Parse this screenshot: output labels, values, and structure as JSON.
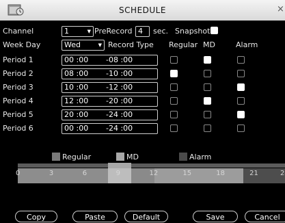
{
  "window": {
    "title": "SCHEDULE",
    "close_glyph": "×"
  },
  "channel": {
    "label": "Channel",
    "value": "1"
  },
  "prerecord": {
    "label": "PreRecord",
    "value": "4",
    "unit": "sec."
  },
  "snapshot": {
    "label": "Snapshot",
    "checked": true
  },
  "weekday": {
    "label": "Week Day",
    "value": "Wed"
  },
  "columns": {
    "record_type": "Record Type",
    "regular": "Regular",
    "md": "MD",
    "alarm": "Alarm"
  },
  "periods": [
    {
      "label": "Period 1",
      "start": "00 :00",
      "end": "-08 :00",
      "regular": false,
      "md": true,
      "alarm": false
    },
    {
      "label": "Period 2",
      "start": "08 :00",
      "end": "-10 :00",
      "regular": true,
      "md": false,
      "alarm": false
    },
    {
      "label": "Period 3",
      "start": "10 :00",
      "end": "-12 :00",
      "regular": false,
      "md": false,
      "alarm": true
    },
    {
      "label": "Period 4",
      "start": "12 :00",
      "end": "-20 :00",
      "regular": false,
      "md": true,
      "alarm": false
    },
    {
      "label": "Period 5",
      "start": "20 :00",
      "end": "-24 :00",
      "regular": false,
      "md": false,
      "alarm": true
    },
    {
      "label": "Period 6",
      "start": "00 :00",
      "end": "-24 :00",
      "regular": false,
      "md": false,
      "alarm": false
    }
  ],
  "legend": [
    {
      "label": "Regular",
      "color": "#7a7a7a"
    },
    {
      "label": "MD",
      "color": "#a8a8a8"
    },
    {
      "label": "Alarm",
      "color": "#4a4a4a"
    }
  ],
  "timeline": {
    "ticks": [
      "0",
      "3",
      "6",
      "9",
      "12",
      "15",
      "18",
      "21",
      "24"
    ]
  },
  "buttons": {
    "copy": "Copy",
    "paste": "Paste",
    "default": "Default",
    "save": "Save",
    "cancel": "Cancel"
  }
}
